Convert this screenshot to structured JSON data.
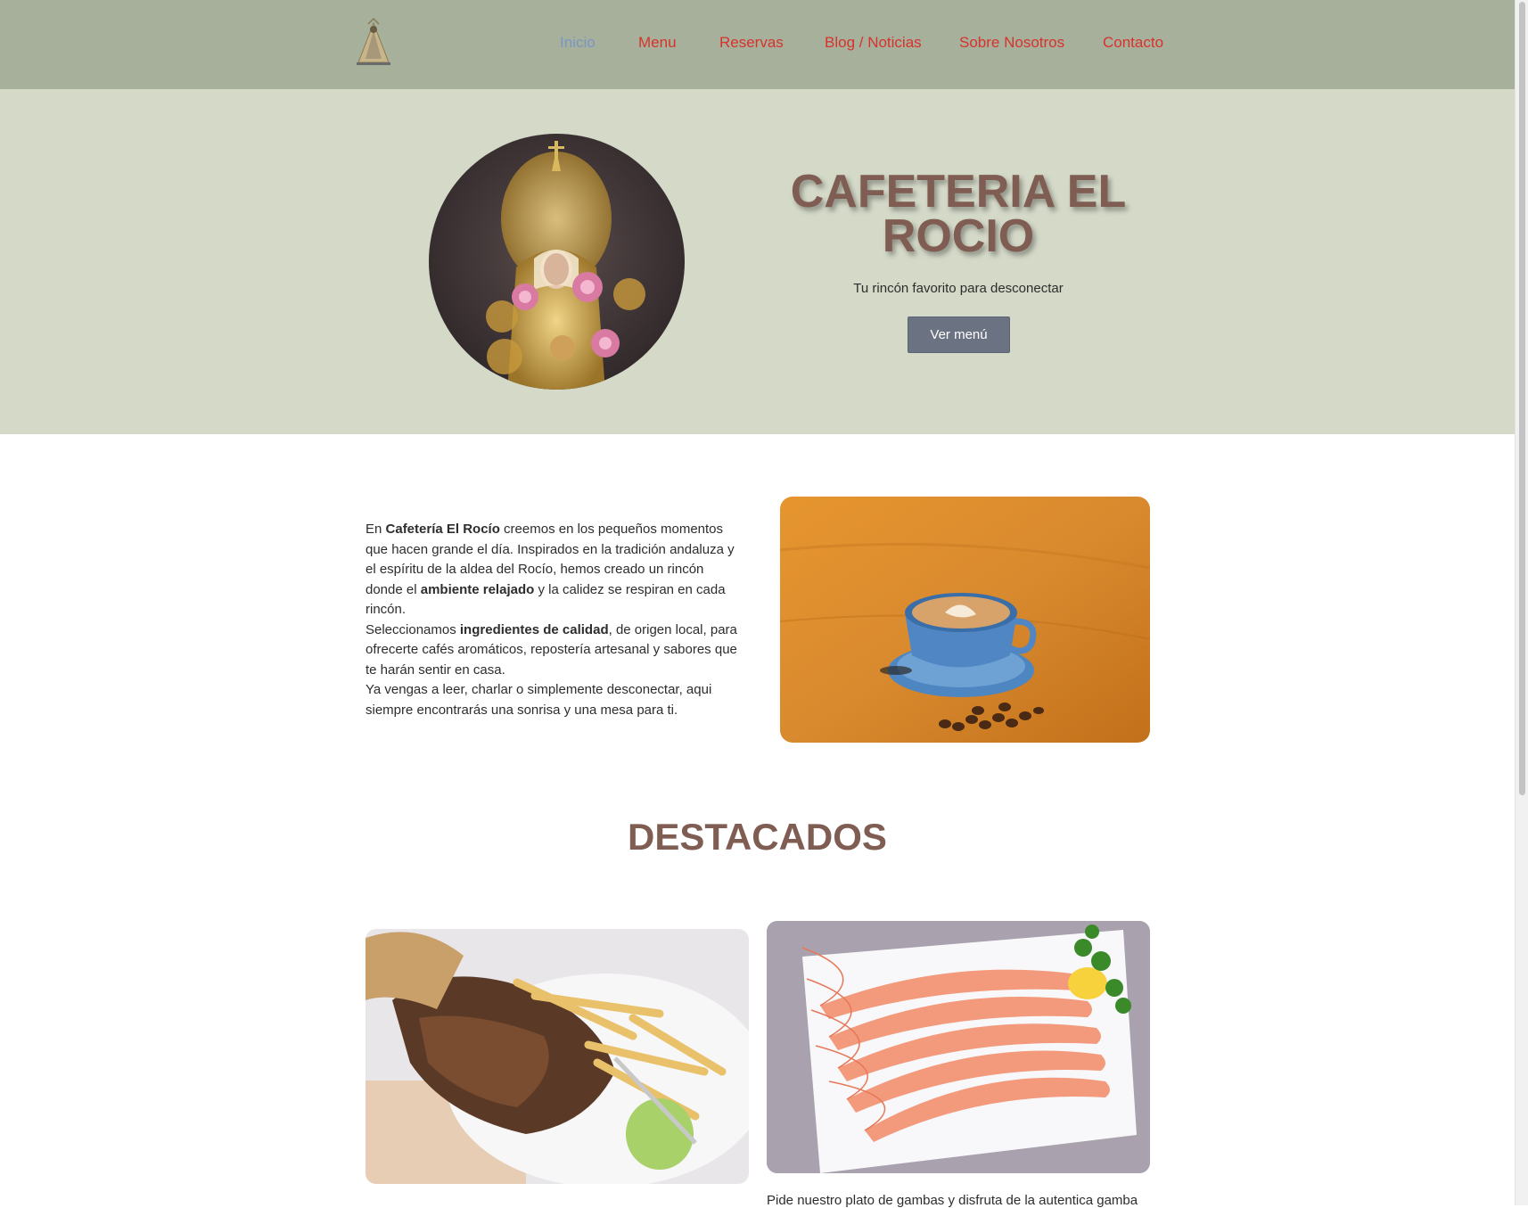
{
  "nav": {
    "items": [
      {
        "label": "Inicio",
        "active": true
      },
      {
        "label": "Menu"
      },
      {
        "label": "Reservas"
      },
      {
        "label": "Blog / Noticias"
      },
      {
        "label": "Sobre Nosotros"
      },
      {
        "label": "Contacto"
      }
    ]
  },
  "hero": {
    "title_line1": "CAFETERIA EL",
    "title_line2": "ROCIO",
    "subtitle": "Tu rincón favorito para desconectar",
    "button_label": "Ver menú"
  },
  "intro": {
    "p1": {
      "t1": "En ",
      "b1": "Cafetería El Rocío",
      "t2": " creemos en los pequeños momentos que hacen grande el día. Inspirados en la tradición andaluza y el espíritu de la aldea del Rocío, hemos creado un rincón donde el ",
      "b2": "ambiente relajado",
      "t3": " y la calidez se respiran en cada rincón."
    },
    "p2": {
      "t1": "Seleccionamos ",
      "b1": "ingredientes de calidad",
      "t2": ", de origen local, para ofrecerte cafés aromáticos, repostería artesanal y sabores que te harán sentir en casa."
    },
    "p3": "Ya vengas a leer, charlar o simplemente desconectar, aqui siempre encontrarás una sonrisa y una mesa para ti."
  },
  "featured": {
    "title": "DESTACADOS",
    "card2_caption": "Pide nuestro plato de gambas y disfruta de la autentica gamba"
  },
  "colors": {
    "header_bg": "#a6b09b",
    "hero_bg": "#d4d9c8",
    "nav_link": "#d8322c",
    "nav_active": "#7b95c5",
    "title_brown": "#7f5d52",
    "button_bg": "#6b7383"
  },
  "images": {
    "logo": "virgin-icon",
    "hero": "virgin-figure-photo",
    "intro": "latte-cup-photo",
    "dish1": "grilled-meat-fries-photo",
    "dish2": "shrimp-platter-photo"
  }
}
